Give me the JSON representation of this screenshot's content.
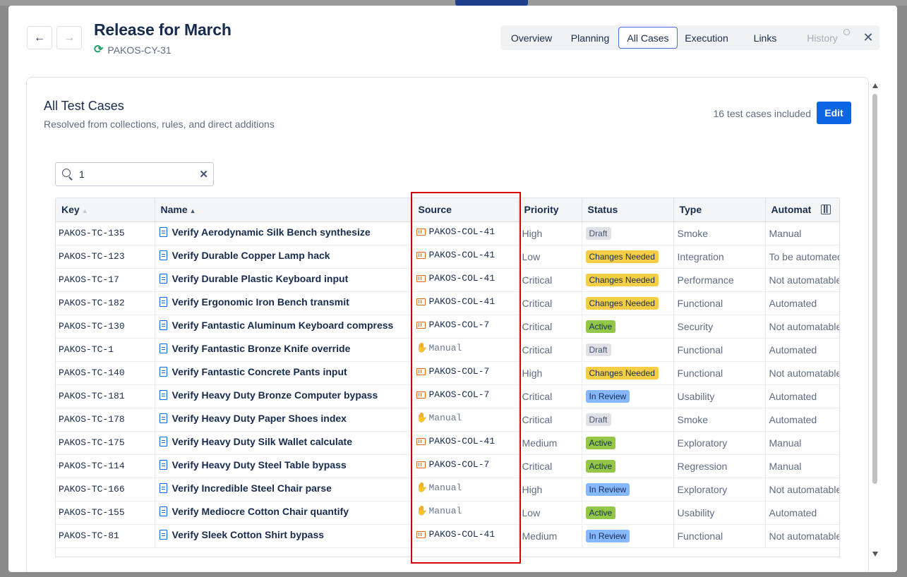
{
  "header": {
    "title": "Release for March",
    "cycle_key": "PAKOS-CY-31"
  },
  "tabs": [
    {
      "label": "Overview"
    },
    {
      "label": "Planning"
    },
    {
      "label": "All Cases"
    },
    {
      "label": "Execution"
    },
    {
      "label": "Links"
    },
    {
      "label": "History"
    }
  ],
  "active_tab": "All Cases",
  "panel": {
    "title": "All Test Cases",
    "subtitle": "Resolved from collections, rules, and direct additions",
    "count_text": "16 test cases included",
    "edit_label": "Edit"
  },
  "search": {
    "value": "1"
  },
  "columns": [
    "Key",
    "Name",
    "Source",
    "Priority",
    "Status",
    "Type",
    "Automat"
  ],
  "rows": [
    {
      "key": "PAKOS-TC-135",
      "name": "Verify Aerodynamic Silk Bench synthesize",
      "source": "PAKOS-COL-41",
      "source_kind": "collection",
      "priority": "High",
      "status": "Draft",
      "type": "Smoke",
      "automation": "Manual"
    },
    {
      "key": "PAKOS-TC-123",
      "name": "Verify Durable Copper Lamp hack",
      "source": "PAKOS-COL-41",
      "source_kind": "collection",
      "priority": "Low",
      "status": "Changes Needed",
      "type": "Integration",
      "automation": "To be automated"
    },
    {
      "key": "PAKOS-TC-17",
      "name": "Verify Durable Plastic Keyboard input",
      "source": "PAKOS-COL-41",
      "source_kind": "collection",
      "priority": "Critical",
      "status": "Changes Needed",
      "type": "Performance",
      "automation": "Not automatable"
    },
    {
      "key": "PAKOS-TC-182",
      "name": "Verify Ergonomic Iron Bench transmit",
      "source": "PAKOS-COL-41",
      "source_kind": "collection",
      "priority": "Critical",
      "status": "Changes Needed",
      "type": "Functional",
      "automation": "Automated"
    },
    {
      "key": "PAKOS-TC-130",
      "name": "Verify Fantastic Aluminum Keyboard compress",
      "source": "PAKOS-COL-7",
      "source_kind": "collection",
      "priority": "Critical",
      "status": "Active",
      "type": "Security",
      "automation": "Not automatable"
    },
    {
      "key": "PAKOS-TC-1",
      "name": "Verify Fantastic Bronze Knife override",
      "source": "Manual",
      "source_kind": "manual",
      "priority": "Critical",
      "status": "Draft",
      "type": "Functional",
      "automation": "Automated"
    },
    {
      "key": "PAKOS-TC-140",
      "name": "Verify Fantastic Concrete Pants input",
      "source": "PAKOS-COL-7",
      "source_kind": "collection",
      "priority": "High",
      "status": "Changes Needed",
      "type": "Functional",
      "automation": "Not automatable"
    },
    {
      "key": "PAKOS-TC-181",
      "name": "Verify Heavy Duty Bronze Computer bypass",
      "source": "PAKOS-COL-7",
      "source_kind": "collection",
      "priority": "Critical",
      "status": "In Review",
      "type": "Usability",
      "automation": "Automated"
    },
    {
      "key": "PAKOS-TC-178",
      "name": "Verify Heavy Duty Paper Shoes index",
      "source": "Manual",
      "source_kind": "manual",
      "priority": "Critical",
      "status": "Draft",
      "type": "Smoke",
      "automation": "Automated"
    },
    {
      "key": "PAKOS-TC-175",
      "name": "Verify Heavy Duty Silk Wallet calculate",
      "source": "PAKOS-COL-41",
      "source_kind": "collection",
      "priority": "Medium",
      "status": "Active",
      "type": "Exploratory",
      "automation": "Manual"
    },
    {
      "key": "PAKOS-TC-114",
      "name": "Verify Heavy Duty Steel Table bypass",
      "source": "PAKOS-COL-7",
      "source_kind": "collection",
      "priority": "Critical",
      "status": "Active",
      "type": "Regression",
      "automation": "Manual"
    },
    {
      "key": "PAKOS-TC-166",
      "name": "Verify Incredible Steel Chair parse",
      "source": "Manual",
      "source_kind": "manual",
      "priority": "High",
      "status": "In Review",
      "type": "Exploratory",
      "automation": "Not automatable"
    },
    {
      "key": "PAKOS-TC-155",
      "name": "Verify Mediocre Cotton Chair quantify",
      "source": "Manual",
      "source_kind": "manual",
      "priority": "Low",
      "status": "Active",
      "type": "Usability",
      "automation": "Automated"
    },
    {
      "key": "PAKOS-TC-81",
      "name": "Verify Sleek Cotton Shirt bypass",
      "source": "PAKOS-COL-41",
      "source_kind": "collection",
      "priority": "Medium",
      "status": "In Review",
      "type": "Functional",
      "automation": "Not automatable"
    }
  ],
  "icons": {
    "back": "arrow-left-icon",
    "forward": "arrow-right-icon",
    "sync": "refresh-icon",
    "search": "search-icon",
    "clear": "clear-icon",
    "test_case": "document-icon",
    "collection": "collection-icon",
    "manual": "hand-icon",
    "columns": "column-settings-icon",
    "close": "close-icon",
    "history": "clock-icon"
  },
  "colors": {
    "primary": "#0c66e4",
    "draft": "#dfe1e6",
    "changes_needed": "#f5cd47",
    "active": "#94c748",
    "in_review": "#85b8ff",
    "collection_icon": "#e56910",
    "highlight": "#d50000"
  }
}
